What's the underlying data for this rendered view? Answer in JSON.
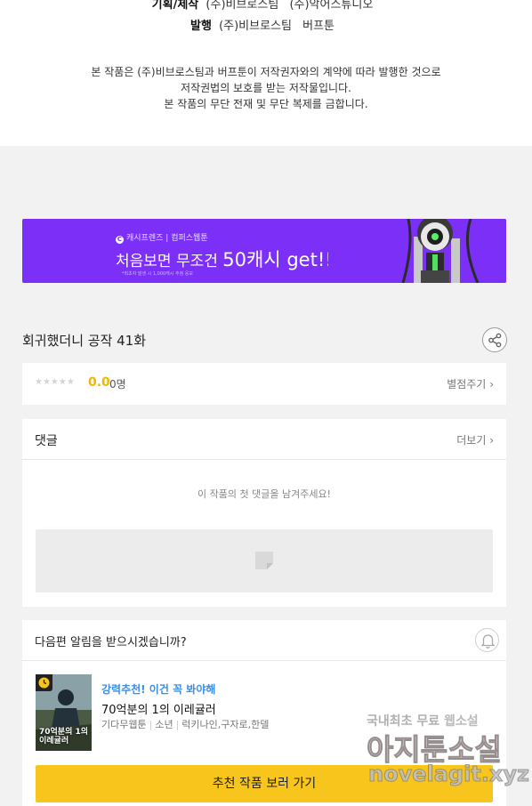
{
  "credits": {
    "planning_label": "기획/제작",
    "planning_companies": [
      "(주)비브로스팀",
      "(주)악어스튜디오"
    ],
    "publish_label": "발행",
    "publish_companies": [
      "(주)비브로스팀",
      "버프툰"
    ],
    "notice_lines": [
      "본 작품은 (주)비브로스팀과 버프툰이 저작권자와의 계약에 따라 발행한 것으로",
      "저작권법의 보호를 받는 저작물입니다.",
      "본 작품의 무단 전재 및 무단 복제를 금합니다."
    ]
  },
  "banner": {
    "brand": "캐시프렌즈",
    "brand_sep": "|",
    "partner": "컴퍼스웹툰",
    "headline_prefix": "처음보면 무조건",
    "headline_amount": "50캐시 get!!",
    "fineprint": "*최초자 발생 시 1,000캐시 추첨 응모",
    "logo_letter": "C",
    "accent_color": "#7b2ff7"
  },
  "episode": {
    "title": "회귀했더니 공작 41화"
  },
  "rating": {
    "stars": "★★★★★",
    "score": "0.0",
    "count": "0명",
    "rate_link": "별점주기",
    "chevron": "›"
  },
  "comments": {
    "title": "댓글",
    "more_link": "더보기",
    "chevron": "›",
    "empty_text": "이 작품의 첫 댓글을 남겨주세요!"
  },
  "notify": {
    "question": "다음편 알림을 받으시겠습니까?",
    "recommendation": {
      "tag": "강력추천! 이건 꼭 봐야해",
      "title": "70억분의 1의 이레귤러",
      "cover_text": "70억분의 1의 이레귤러",
      "meta": [
        "기다무웹툰",
        "소년",
        "럭키나인,구자로,한델"
      ],
      "button_label": "추천 작품 보러 가기"
    },
    "button_color": "#f8c51c"
  },
  "watermark": {
    "line1_prefix": "국내최초 무료",
    "line1_highlight": "웹소설",
    "line2": "아지툰소설",
    "line3": "novelagit.xyz"
  }
}
